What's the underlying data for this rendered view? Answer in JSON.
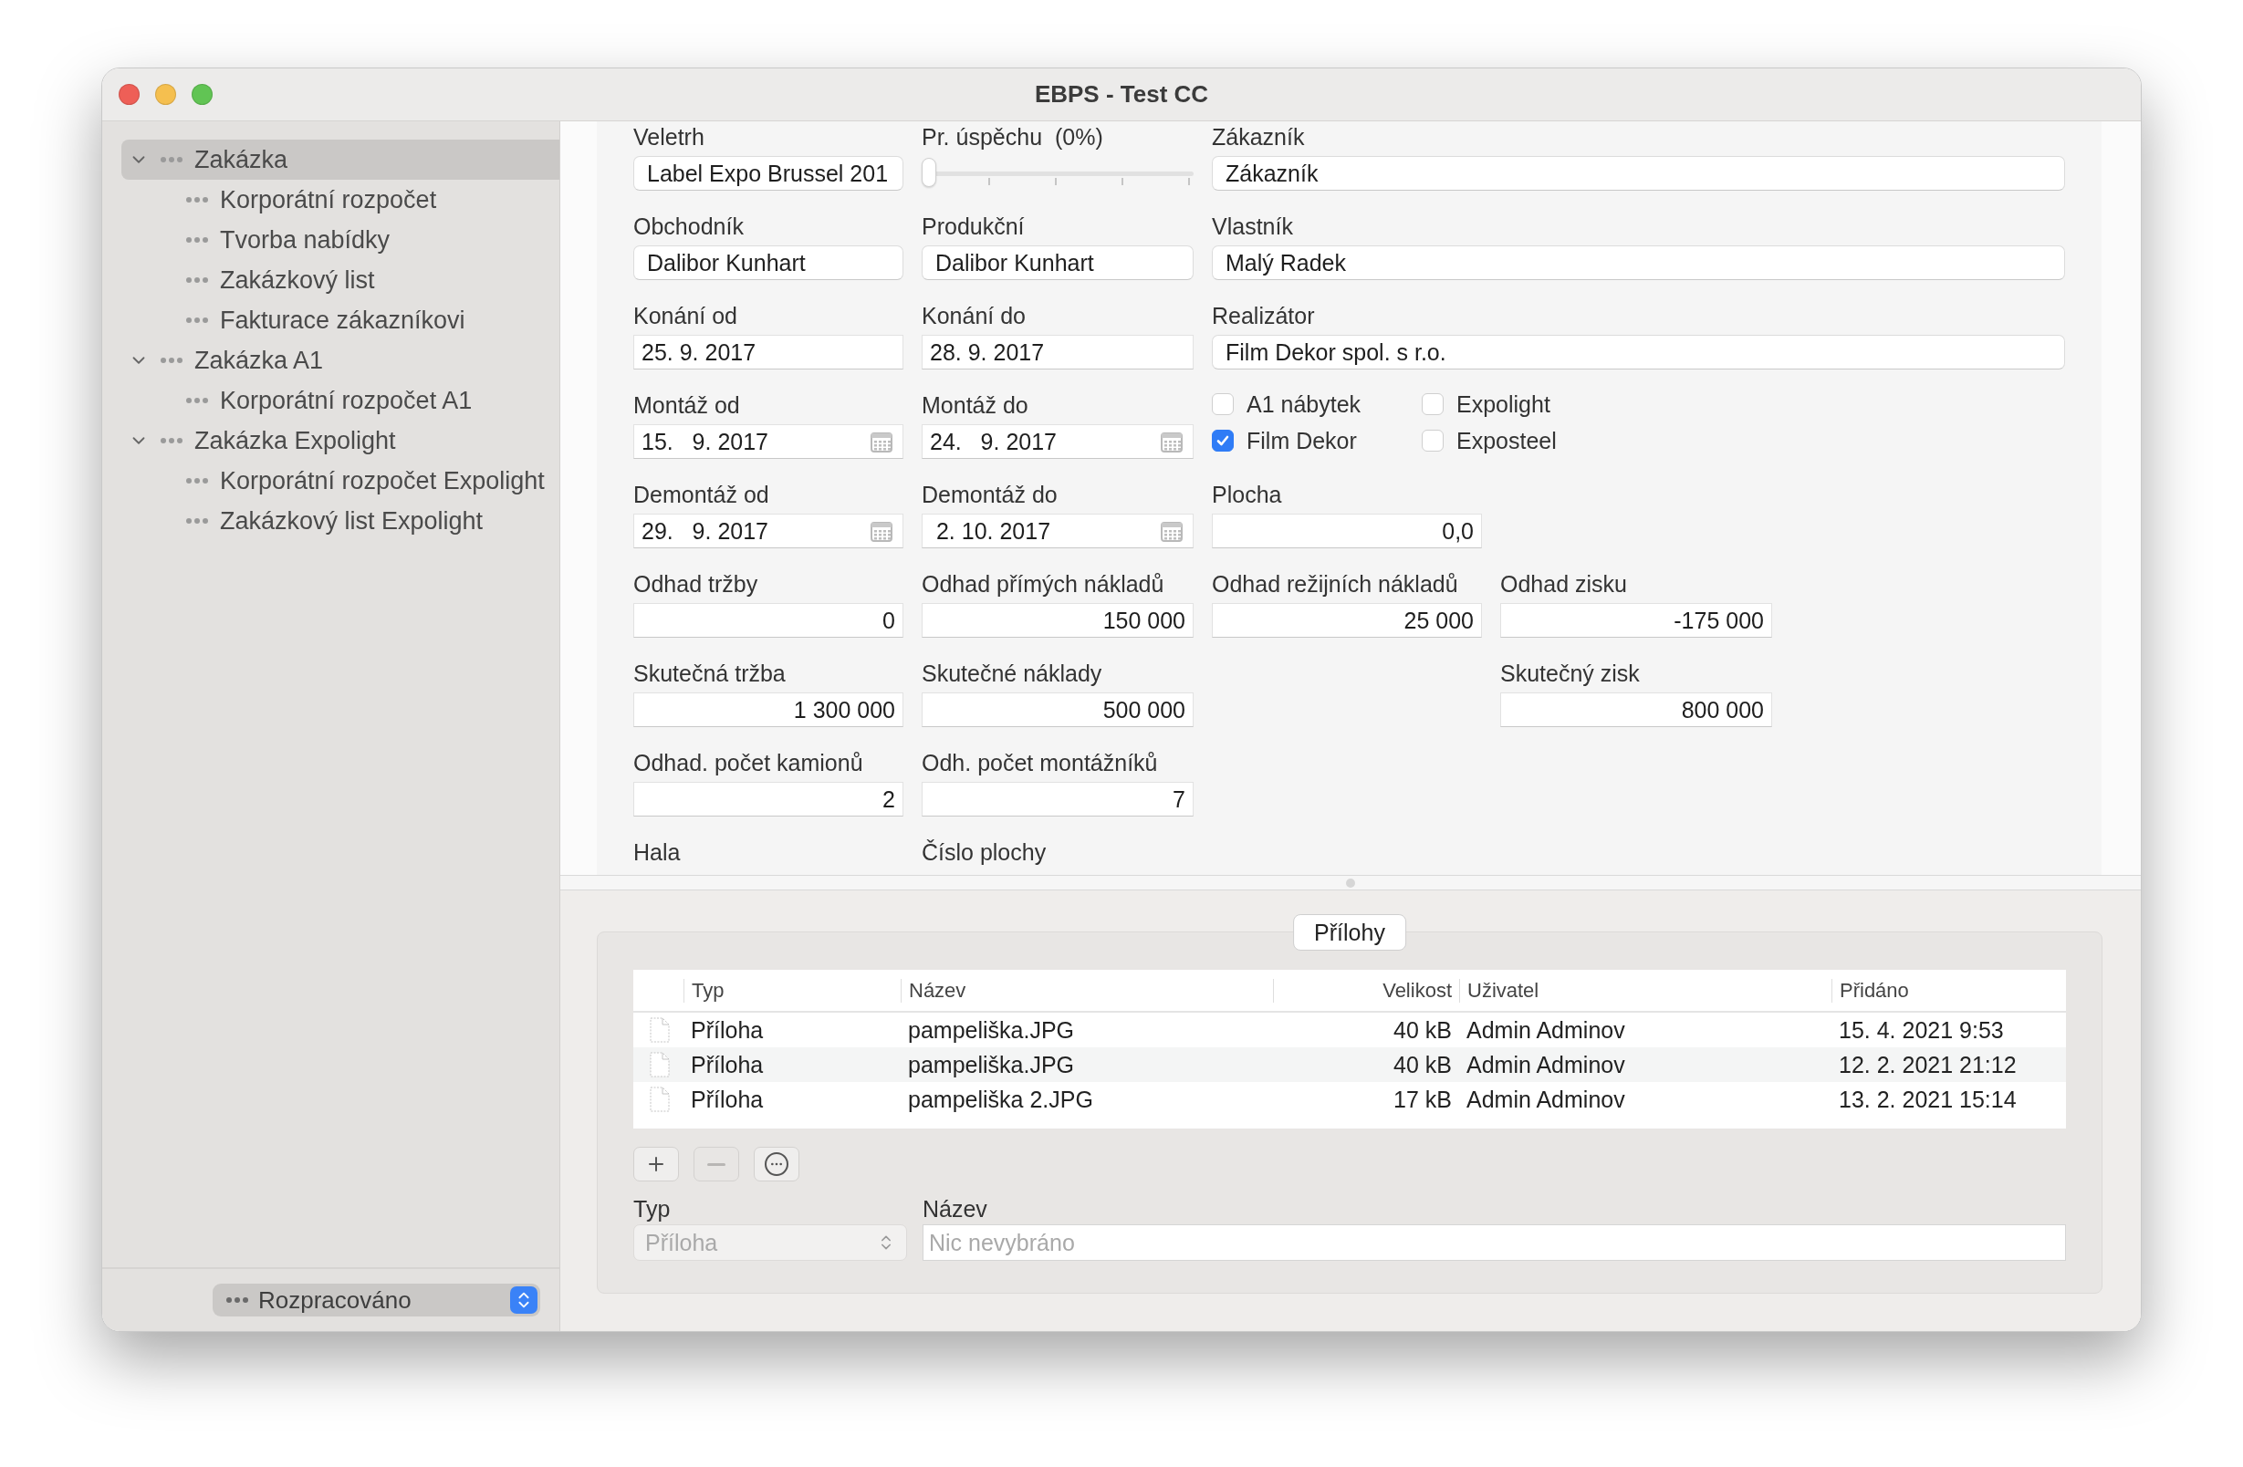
{
  "window": {
    "title": "EBPS - Test CC"
  },
  "sidebar": {
    "items": [
      {
        "label": "Zakázka",
        "expanded": true,
        "selected": true,
        "children": [
          {
            "label": "Korporátní rozpočet",
            "selected": false
          },
          {
            "label": "Tvorba nabídky",
            "selected": false
          },
          {
            "label": "Zakázkový list",
            "selected": false
          },
          {
            "label": "Fakturace zákazníkovi",
            "selected": false
          }
        ]
      },
      {
        "label": "Zakázka A1",
        "expanded": true,
        "selected": false,
        "children": [
          {
            "label": "Korporátní rozpočet A1",
            "selected": false
          }
        ]
      },
      {
        "label": "Zakázka Expolight",
        "expanded": true,
        "selected": false,
        "children": [
          {
            "label": "Korporátní rozpočet Expolight",
            "selected": false
          },
          {
            "label": "Zakázkový list Expolight",
            "selected": false
          }
        ]
      }
    ],
    "status": "Rozpracováno"
  },
  "form": {
    "rows": [
      [
        {
          "kind": "text",
          "label": "Veletrh",
          "value": "Label Expo Brussel 201"
        },
        {
          "kind": "slider",
          "label": "Pr. úspěchu  (0%)",
          "level": 0
        },
        {
          "kind": "wide",
          "label": "Zákazník",
          "value": "Zákazník"
        }
      ],
      [
        {
          "kind": "text",
          "label": "Obchodník",
          "value": "Dalibor Kunhart"
        },
        {
          "kind": "text",
          "label": "Produkční",
          "value": "Dalibor Kunhart"
        },
        {
          "kind": "wide",
          "label": "Vlastník",
          "value": "Malý Radek"
        }
      ],
      [
        {
          "kind": "date",
          "label": "Konání od",
          "value": "25. 9. 2017"
        },
        {
          "kind": "date",
          "label": "Konání do",
          "value": "28. 9. 2017"
        },
        {
          "kind": "wide",
          "label": "Realizátor",
          "value": "Film Dekor spol. s r.o."
        }
      ],
      [
        {
          "kind": "picker",
          "label": "Montáž od",
          "value": "15.   9. 2017"
        },
        {
          "kind": "picker",
          "label": "Montáž do",
          "value": "24.   9. 2017"
        },
        {
          "kind": "checks",
          "options": [
            {
              "label": "A1 nábytek",
              "checked": false
            },
            {
              "label": "Expolight",
              "checked": false
            },
            {
              "label": "Film Dekor",
              "checked": true
            },
            {
              "label": "Exposteel",
              "checked": false
            }
          ]
        }
      ],
      [
        {
          "kind": "picker",
          "label": "Demontáž od",
          "value": "29.   9. 2017"
        },
        {
          "kind": "picker",
          "label": "Demontáž do",
          "value": " 2. 10. 2017"
        },
        {
          "kind": "number",
          "label": "Plocha",
          "value": "0,0"
        }
      ],
      [
        {
          "kind": "number",
          "label": "Odhad tržby",
          "value": "0"
        },
        {
          "kind": "number",
          "label": "Odhad přímých nákladů",
          "value": "150 000"
        },
        {
          "kind": "number",
          "label": "Odhad režijních nákladů",
          "value": "25 000"
        },
        {
          "kind": "number",
          "label": "Odhad zisku",
          "value": "-175 000"
        }
      ],
      [
        {
          "kind": "number",
          "label": "Skutečná tržba",
          "value": "1 300 000"
        },
        {
          "kind": "number",
          "label": "Skutečné náklady",
          "value": "500 000"
        },
        {
          "kind": "profit",
          "label": "Skutečný zisk",
          "value": "800 000"
        }
      ],
      [
        {
          "kind": "number",
          "label": "Odhad. počet kamionů",
          "value": "2"
        },
        {
          "kind": "number",
          "label": "Odh. počet montážníků",
          "value": "7"
        }
      ],
      [
        {
          "kind": "label",
          "label": "Hala"
        },
        {
          "kind": "label",
          "label": "Číslo plochy"
        }
      ]
    ]
  },
  "attachments": {
    "title": "Přílohy",
    "columns": [
      "Typ",
      "Název",
      "Velikost",
      "Uživatel",
      "Přidáno"
    ],
    "rows": [
      [
        "Příloha",
        "pampeliška.JPG",
        "40 kB",
        "Admin Adminov",
        "15. 4. 2021 9:53"
      ],
      [
        "Příloha",
        "pampeliška.JPG",
        "40 kB",
        "Admin Adminov",
        "12. 2. 2021 21:12"
      ],
      [
        "Příloha",
        "pampeliška 2.JPG",
        "17 kB",
        "Admin Adminov",
        "13. 2. 2021 15:14"
      ]
    ],
    "buttons": [
      {
        "kind": "add",
        "disabled": false
      },
      {
        "kind": "remove",
        "disabled": true
      },
      {
        "kind": "more",
        "disabled": false
      }
    ],
    "type_field": {
      "label": "Typ",
      "value": "Příloha",
      "disabled": true
    },
    "name_field": {
      "label": "Název",
      "placeholder": "Nic nevybráno"
    }
  }
}
